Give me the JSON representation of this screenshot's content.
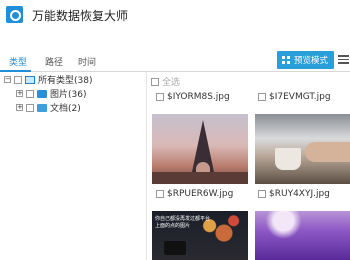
{
  "app": {
    "title": "万能数据恢复大师"
  },
  "tabs": [
    {
      "label": "类型",
      "active": true
    },
    {
      "label": "路径",
      "active": false
    },
    {
      "label": "时间",
      "active": false
    }
  ],
  "toolbar": {
    "preview_label": "预览模式"
  },
  "tree": [
    {
      "expander": "−",
      "label": "所有类型(38)"
    },
    {
      "expander": "+",
      "label": "图片(36)"
    },
    {
      "expander": "+",
      "label": "文档(2)"
    }
  ],
  "content": {
    "select_all_label": "全选",
    "files": [
      {
        "name": "$IYORM8S.jpg"
      },
      {
        "name": "$I7EVMGT.jpg"
      },
      {
        "name": "$RPUER6W.jpg"
      },
      {
        "name": "$RUY4XYJ.jpg"
      }
    ],
    "thumb_overlay_text": "你自己都没再发过都平台上面的点的图片"
  },
  "colors": {
    "accent": "#1f8fd8",
    "button": "#2a9ed8"
  }
}
